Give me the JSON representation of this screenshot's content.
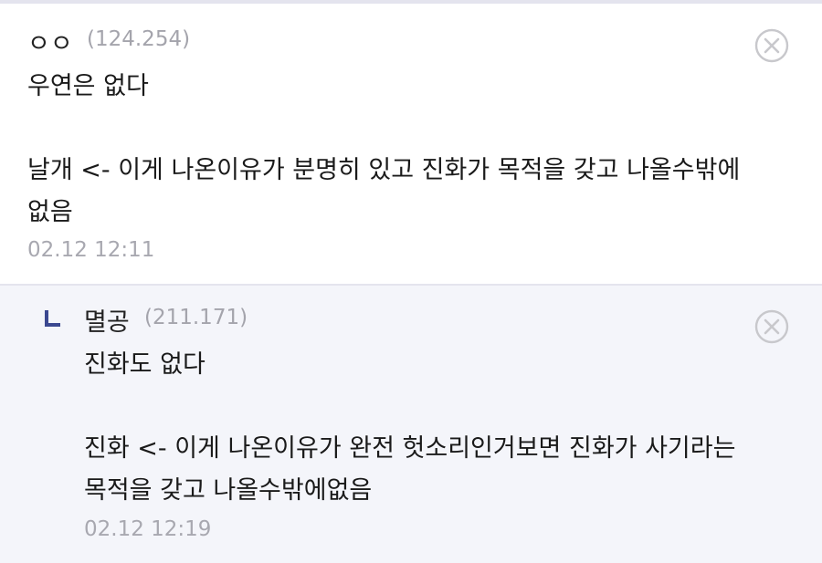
{
  "main_comment": {
    "nickname": "ㅇㅇ",
    "ip": "(124.254)",
    "body": "우연은 없다\n\n날개 <- 이게 나온이유가 분명히 있고 진화가 목적을 갖고 나올수밖에\n없음",
    "timestamp": "02.12 12:11",
    "delete_icon": "circle-x-icon"
  },
  "reply": {
    "reply_icon": "reply-arrow-icon",
    "nickname": "멸공",
    "ip": "(211.171)",
    "body": "진화도 없다\n\n진화 <- 이게 나온이유가 완전 헛소리인거보면 진화가 사기라는\n목적을 갖고 나올수밖에없음",
    "timestamp": "02.12 12:19",
    "delete_icon": "circle-x-icon"
  },
  "colors": {
    "reply_background": "#f4f5fa",
    "reply_icon": "#3b4890",
    "muted_text": "#a8a8b0",
    "delete_icon": "#c8c8cc"
  }
}
